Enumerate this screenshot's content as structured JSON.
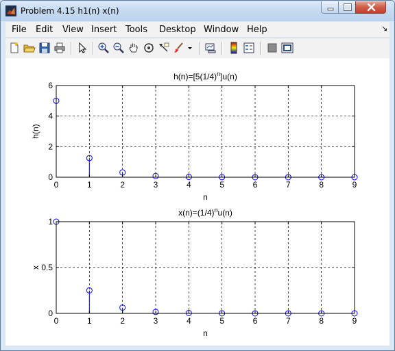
{
  "window": {
    "title": "Problem 4.15 h1(n) x(n)",
    "controls": [
      "minimize",
      "maximize",
      "close"
    ]
  },
  "menu": {
    "items": [
      "File",
      "Edit",
      "View",
      "Insert",
      "Tools",
      "Desktop",
      "Window",
      "Help"
    ],
    "dock_glyph": "↘"
  },
  "toolbar": {
    "icons": [
      "new-figure-icon",
      "open-file-icon",
      "save-icon",
      "print-icon",
      "edit-plot-arrow-icon",
      "zoom-in-icon",
      "zoom-out-icon",
      "pan-hand-icon",
      "rotate-3d-icon",
      "data-cursor-icon",
      "brush-icon",
      "brush-dropdown-icon",
      "link-plot-icon",
      "colorbar-icon",
      "legend-icon",
      "hide-plot-tools-icon",
      "show-plot-tools-icon"
    ]
  },
  "colors": {
    "stem": "#0000ff",
    "grid": "#000000",
    "figure_bg": "#ffffff"
  },
  "chart_data": [
    {
      "type": "stem",
      "title_main": "h(n)=[5(1/4)",
      "title_sup": "n",
      "title_tail": "]u(n)",
      "xlabel": "n",
      "ylabel": "h(n)",
      "x": [
        0,
        1,
        2,
        3,
        4,
        5,
        6,
        7,
        8,
        9
      ],
      "values": [
        5,
        1.25,
        0.3125,
        0.078125,
        0.01953,
        0.00488,
        0.00122,
        0.0003,
        8e-05,
        2e-05
      ],
      "xlim": [
        0,
        9
      ],
      "ylim": [
        0,
        6
      ],
      "xticks": [
        "0",
        "1",
        "2",
        "3",
        "4",
        "5",
        "6",
        "7",
        "8",
        "9"
      ],
      "yticks": [
        "0",
        "2",
        "4",
        "6"
      ],
      "grid": true
    },
    {
      "type": "stem",
      "title_main": "x(n)=(1/4)",
      "title_sup": "n",
      "title_tail": "u(n)",
      "xlabel": "n",
      "ylabel": "x",
      "x": [
        0,
        1,
        2,
        3,
        4,
        5,
        6,
        7,
        8,
        9
      ],
      "values": [
        1,
        0.25,
        0.0625,
        0.015625,
        0.0039,
        0.00098,
        0.00024,
        6e-05,
        1.5e-05,
        4e-06
      ],
      "xlim": [
        0,
        9
      ],
      "ylim": [
        0,
        1
      ],
      "xticks": [
        "0",
        "1",
        "2",
        "3",
        "4",
        "5",
        "6",
        "7",
        "8",
        "9"
      ],
      "yticks": [
        "0",
        "0.5",
        "1"
      ],
      "grid": true
    }
  ]
}
